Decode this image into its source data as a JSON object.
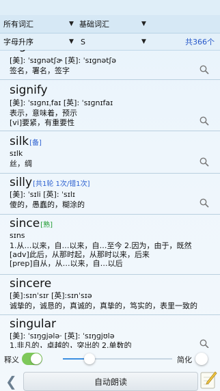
{
  "filters": {
    "vocab_scope": "所有词汇",
    "vocab_level": "基础词汇",
    "sort_order": "字母升序",
    "letter": "S",
    "total_count": "共366个"
  },
  "items": [
    {
      "word": "signature",
      "tag": "",
      "lines": [
        "[美]: ˈsɪɡnətʃɚ [英]: ˈsɪɡnətʃə",
        "签名，署名，签字"
      ]
    },
    {
      "word": "signify",
      "tag": "",
      "lines": [
        "[美]: ˈsɪɡnɪˌfaɪ [英]: ˈsɪɡnɪfaɪ",
        "表示，意味着，预示",
        "[vi]要紧，有重要性"
      ]
    },
    {
      "word": "silk",
      "tag": "[备]",
      "lines": [
        "sɪlk",
        "丝，绸"
      ]
    },
    {
      "word": "silly",
      "tag": "[共1轮 1次/错1次]",
      "lines": [
        "[美]: ˈsɪli [英]: ˈsɪlɪ",
        "傻的，愚蠢的，糊涂的"
      ]
    },
    {
      "word": "since",
      "tag": "[熟]",
      "lines": [
        "sɪns",
        "1.从…以来，自…以来，自…至今 2.因为，由于，既然",
        "[adv]此后，从那时起，从那时以来，后来",
        "[prep]自从，从…以来，自…以后"
      ]
    },
    {
      "word": "sincere",
      "tag": "",
      "lines": [
        "[美]:sɪnˈsɪr [英]:sɪnˈsɪə",
        "诚挚的，诚恳的，真诚的，真挚的，笃实的，表里一致的"
      ]
    },
    {
      "word": "singular",
      "tag": "",
      "lines": [
        "[美]: ˈsɪŋɡjələ· [英]: ˈsɪŋɡjʊlə",
        "1.非凡的，卓越的，突出的 2.单数的"
      ]
    }
  ],
  "bottom": {
    "explain_label": "释义",
    "simplified_label": "简化",
    "auto_read_label": "自动朗读",
    "explain_on": true,
    "simplified_on": false,
    "speed_fraction": 0.25
  },
  "colors": {
    "accent": "#2456c9",
    "toggle_on": "#7ec85a",
    "green_tag": "#1c9a2e"
  }
}
